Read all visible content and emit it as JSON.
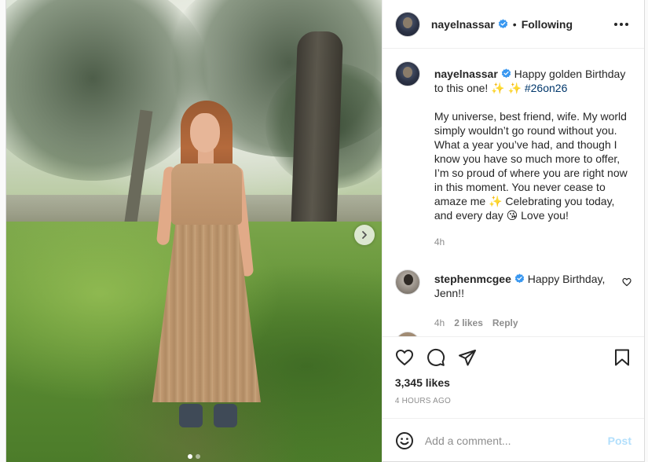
{
  "post": {
    "author": "nayelnassar",
    "follow_status": "Following",
    "separator": "•",
    "caption": {
      "line1": "Happy golden Birthday to this one! ✨ ✨",
      "hashtag": "#26on26",
      "paragraph": "My universe, best friend, wife. My world simply wouldn’t go round without you. What a year you’ve had, and though I know you have so much more to offer, I’m so proud of where you are right now in this moment. You never cease to amaze me ✨ Celebrating you today, and every day 😘 Love you!",
      "time": "4h"
    },
    "comments": [
      {
        "username": "stephenmcgee",
        "text": "Happy Birthday, Jenn!!",
        "time": "4h",
        "likes": "2 likes",
        "reply_label": "Reply"
      }
    ],
    "likes": "3,345 likes",
    "posted_ago": "4 HOURS AGO",
    "add_comment": {
      "placeholder": "Add a comment...",
      "post_label": "Post"
    },
    "carousel": {
      "total_slides": 2,
      "active_slide": 1
    }
  },
  "icons": {
    "verified": "verified-badge-icon",
    "more": "more-options-icon",
    "like": "heart-icon",
    "comment": "comment-bubble-icon",
    "share": "paper-plane-icon",
    "save": "bookmark-icon",
    "emoji": "smiley-icon",
    "next": "chevron-right-icon"
  },
  "colors": {
    "verified_blue": "#3897f0",
    "hashtag": "#00376b",
    "post_button_disabled": "#b2dffc",
    "muted_text": "#8e8e8e"
  }
}
